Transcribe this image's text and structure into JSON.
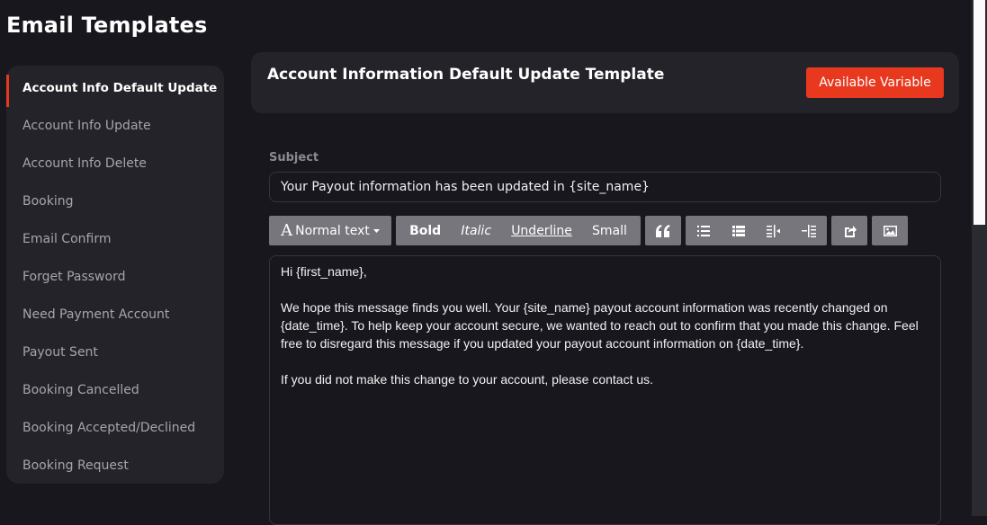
{
  "page": {
    "title": "Email Templates"
  },
  "sidebar": {
    "items": [
      {
        "label": "Account Info Default Update",
        "active": true
      },
      {
        "label": "Account Info Update"
      },
      {
        "label": "Account Info Delete"
      },
      {
        "label": "Booking"
      },
      {
        "label": "Email Confirm"
      },
      {
        "label": "Forget Password"
      },
      {
        "label": "Need Payment Account"
      },
      {
        "label": "Payout Sent"
      },
      {
        "label": "Booking Cancelled"
      },
      {
        "label": "Booking Accepted/Declined"
      },
      {
        "label": "Booking Request"
      }
    ]
  },
  "template": {
    "title": "Account Information Default Update Template",
    "variables_button": "Available Variable"
  },
  "subject": {
    "label": "Subject",
    "value": "Your Payout information has been updated in {site_name}"
  },
  "toolbar": {
    "normal_text": "Normal text",
    "bold": "Bold",
    "italic": "Italic",
    "underline": "Underline",
    "small": "Small"
  },
  "editor": {
    "paragraphs": [
      "Hi {first_name},",
      "We hope this message finds you well. Your {site_name} payout account information was recently changed on {date_time}. To help keep your account secure, we wanted to reach out to confirm that you made this change. Feel free to disregard this message if you updated your payout account information on {date_time}.",
      "If you did not make this change to your account, please contact us."
    ]
  },
  "colors": {
    "accent": "#e8391e",
    "background": "#17171d",
    "panel": "#232329",
    "toolbar": "#76767c"
  },
  "icons": [
    "font-icon",
    "caret-down-icon",
    "quote-icon",
    "unordered-list-icon",
    "ordered-list-icon",
    "outdent-icon",
    "indent-icon",
    "link-icon",
    "image-icon"
  ]
}
